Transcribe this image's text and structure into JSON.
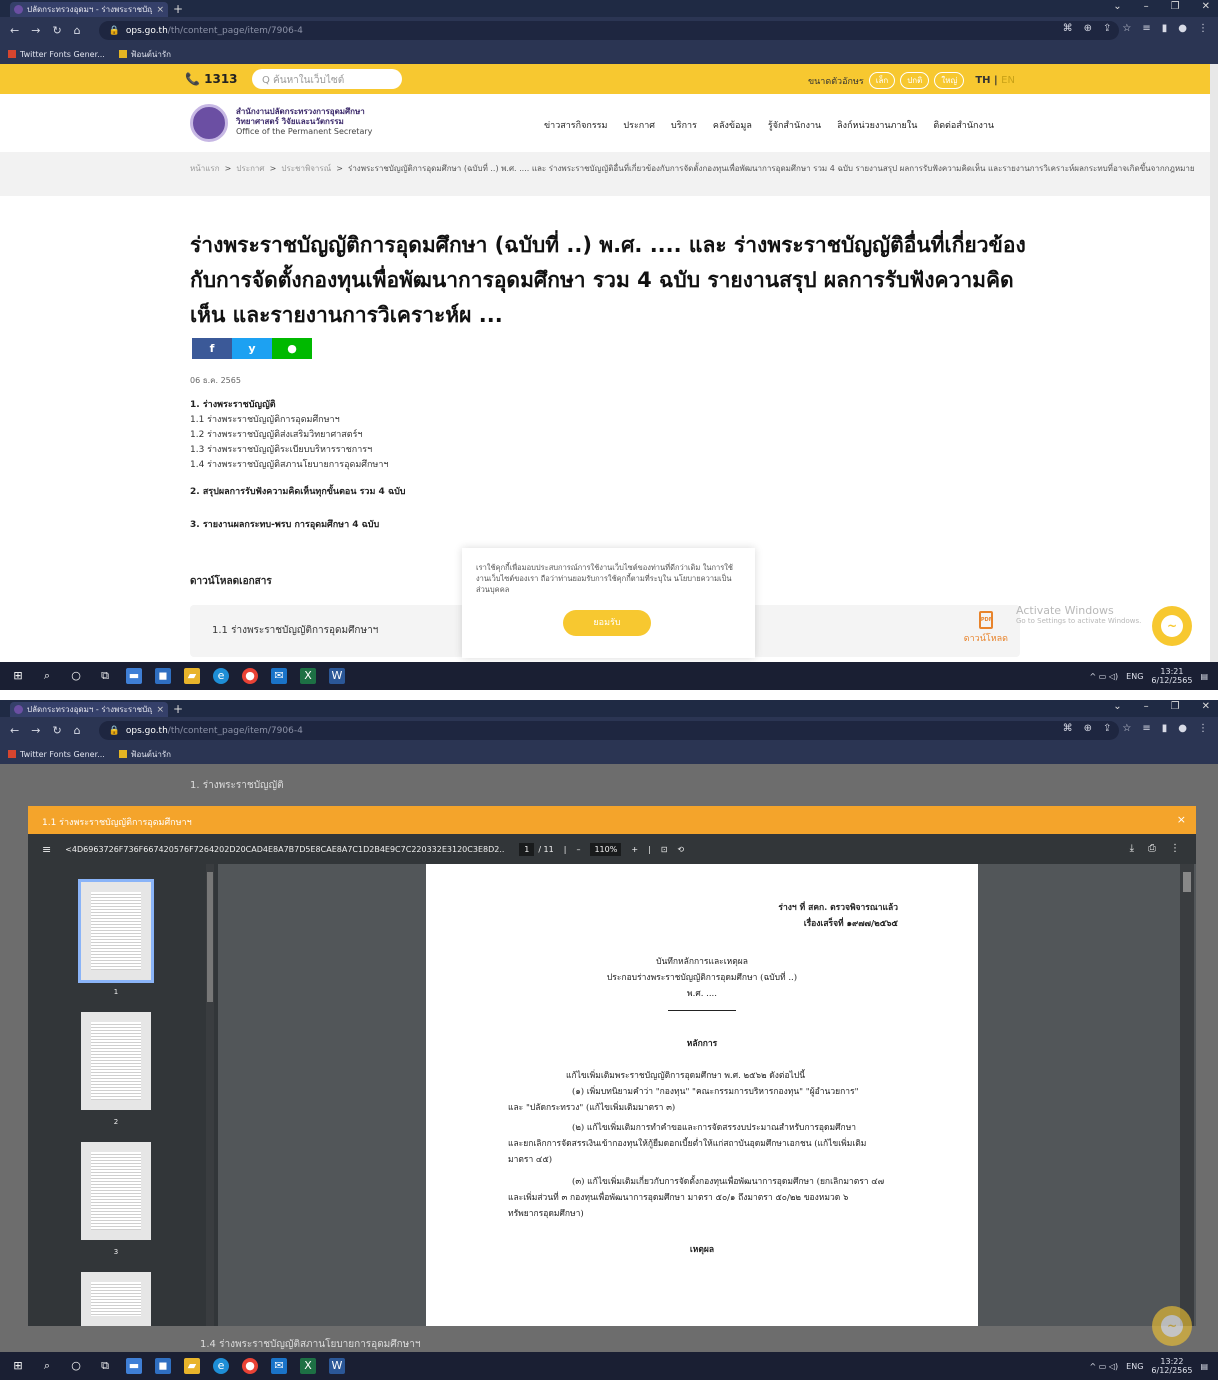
{
  "browser": {
    "tab_title": "ปลัดกระทรวงอุดมฯ - ร่างพระราชบัญญัติการ",
    "tab_close": "×",
    "new_tab": "+",
    "url_domain": "ops.go.th",
    "url_path": "/th/content_page/item/7906-4",
    "bookmarks": [
      "Twitter Fonts Gener...",
      "ฟ้อนต์น่ารัก"
    ],
    "tray_lang": "ENG",
    "clock1_time": "13:21",
    "clock2_time": "13:22",
    "clock_date": "6/12/2565"
  },
  "site": {
    "phone": "📞 1313",
    "search_placeholder": "Q ค้นหาในเว็บไซต์",
    "font_size_label": "ขนาดตัวอักษร",
    "font_sizes": [
      "เล็ก",
      "ปกติ",
      "ใหญ่"
    ],
    "lang_th": "TH",
    "lang_en": "EN",
    "org_th1": "สำนักงานปลัดกระทรวงการอุดมศึกษา",
    "org_th2": "วิทยาศาสตร์ วิจัยและนวัตกรรม",
    "org_en": "Office of the Permanent Secretary",
    "menu": [
      "ข่าวสารกิจกรรม",
      "ประกาศ",
      "บริการ",
      "คลังข้อมูล",
      "รู้จักสำนักงาน",
      "ลิงก์หน่วยงานภายใน",
      "ติดต่อสำนักงาน"
    ],
    "breadcrumb": {
      "home": "หน้าแรก",
      "announce": "ประกาศ",
      "hearing": "ประชาพิจารณ์",
      "current": "ร่างพระราชบัญญัติการอุดมศึกษา (ฉบับที่ ..) พ.ศ. .... และ ร่างพระราชบัญญัติอื่นที่เกี่ยวข้องกับการจัดตั้งกองทุนเพื่อพัฒนาการอุดมศึกษา รวม 4 ฉบับ รายงานสรุป ผลการรับฟังความคิดเห็น และรายงานการวิเคราะห์ผลกระทบที่อาจเกิดขึ้นจากกฎหมาย"
    },
    "title": "ร่างพระราชบัญญัติการอุดมศึกษา (ฉบับที่ ..) พ.ศ. .... และ ร่างพระราชบัญญัติอื่นที่เกี่ยวข้องกับการจัดตั้งกองทุนเพื่อพัฒนาการอุดมศึกษา รวม 4 ฉบับ รายงานสรุป ผลการรับฟังความคิดเห็น และรายงานการวิเคราะห์ผ ...",
    "share": [
      "f",
      "y",
      "●"
    ],
    "date": "06 ธ.ค. 2565",
    "section1": "1. ร่างพระราชบัญญัติ",
    "items": [
      "1.1 ร่างพระราชบัญญัติการอุดมศึกษาฯ",
      "1.2 ร่างพระราชบัญญัติส่งเสริมวิทยาศาสตร์ฯ",
      "1.3 ร่างพระราชบัญญัติระเบียบบริหารราชการฯ",
      "1.4 ร่างพระราชบัญญัติสภานโยบายการอุดมศึกษาฯ"
    ],
    "section2": "2. สรุปผลการรับฟังความคิดเห็นทุกขั้นตอน รวม 4 ฉบับ",
    "section3": "3. รายงานผลกระทบ-พรบ การอุดมศึกษา 4 ฉบับ",
    "download_heading": "ดาวน์โหลดเอกสาร",
    "download_row1": "1.1 ร่างพระราชบัญญัติการอุดมศึกษาฯ",
    "download_row4": "1.4 ร่างพระราชบัญญัติสภานโยบายการอุดมศึกษาฯ",
    "pdf_label": "PDF",
    "download_label": "ดาวน์โหลด",
    "cookie_text": "เราใช้คุกกี้เพื่อมอบประสบการณ์การใช้งานเว็บไซต์ของท่านที่ดีกว่าเดิม ในการใช้งานเว็บไซต์ของเรา ถือว่าท่านยอมรับการใช้คุกกี้ตามที่ระบุใน นโยบายความเป็นส่วนบุคคล",
    "cookie_accept": "ยอมรับ",
    "activate_title": "Activate Windows",
    "activate_sub": "Go to Settings to activate Windows."
  },
  "modal": {
    "title": "1.1 ร่างพระราชบัญญัติการอุดมศึกษาฯ",
    "close": "×",
    "file_name": "<4D6963726F736F667420576F7264202D20CAD4E8A7B7D5E8CAE8A7C1D2B4E9C7C220332E3120C3E8D2...",
    "page_current": "1",
    "page_total": "/ 11",
    "zoom": "110%",
    "thumb_labels": [
      "1",
      "2",
      "3"
    ],
    "doc": {
      "draft_line1": "ร่างฯ ที่ สคก. ตรวจพิจารณาแล้ว",
      "draft_line2": "เรื่องเสร็จที่ ๑๙๗๗/๒๕๖๕",
      "memo_title": "บันทึกหลักการและเหตุผล",
      "memo_sub": "ประกอบร่างพระราชบัญญัติการอุดมศึกษา (ฉบับที่ ..)",
      "memo_year": "พ.ศ. ....",
      "principle_heading": "หลักการ",
      "p_intro": "แก้ไขเพิ่มเติมพระราชบัญญัติการอุดมศึกษา พ.ศ. ๒๕๖๒ ดังต่อไปนี้",
      "p1a": "(๑) เพิ่มบทนิยามคำว่า \"กองทุน\" \"คณะกรรมการบริหารกองทุน\" \"ผู้อำนวยการ\"",
      "p1b": "และ \"ปลัดกระทรวง\" (แก้ไขเพิ่มเติมมาตรา ๓)",
      "p2a": "(๒) แก้ไขเพิ่มเติมการทำคำขอและการจัดสรรงบประมาณสำหรับการอุดมศึกษา",
      "p2b": "และยกเลิกการจัดสรรเงินเข้ากองทุนให้กู้ยืมดอกเบี้ยต่ำให้แก่สถาบันอุดมศึกษาเอกชน (แก้ไขเพิ่มเติม",
      "p2c": "มาตรา ๔๕)",
      "p3a": "(๓) แก้ไขเพิ่มเติมเกี่ยวกับการจัดตั้งกองทุนเพื่อพัฒนาการอุดมศึกษา (ยกเลิกมาตรา ๔๗",
      "p3b": "และเพิ่มส่วนที่ ๓ กองทุนเพื่อพัฒนาการอุดมศึกษา มาตรา ๕๐/๑ ถึงมาตรา ๕๐/๒๒ ของหมวด ๖",
      "p3c": "ทรัพยากรอุดมศึกษา)",
      "reason_heading": "เหตุผล"
    }
  }
}
